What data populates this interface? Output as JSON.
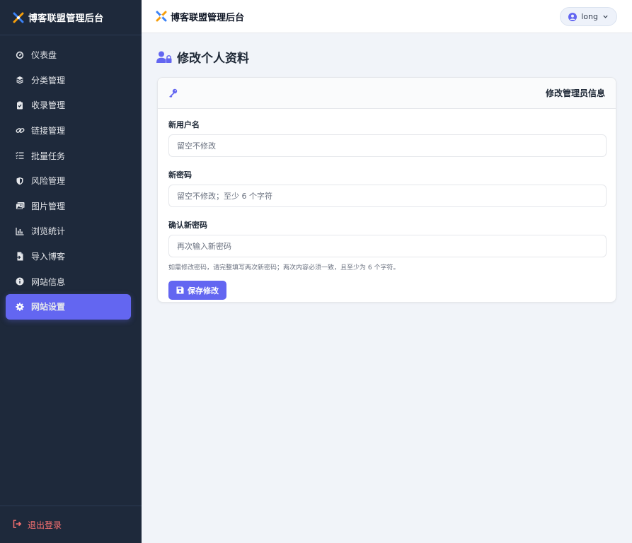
{
  "sidebar": {
    "brand": "博客联盟管理后台",
    "items": [
      {
        "label": "仪表盘",
        "icon": "dashboard-icon"
      },
      {
        "label": "分类管理",
        "icon": "layers-icon"
      },
      {
        "label": "收录管理",
        "icon": "clipboard-check-icon"
      },
      {
        "label": "链接管理",
        "icon": "link-icon"
      },
      {
        "label": "批量任务",
        "icon": "tasks-icon"
      },
      {
        "label": "风险管理",
        "icon": "shield-icon"
      },
      {
        "label": "图片管理",
        "icon": "image-icon"
      },
      {
        "label": "浏览统计",
        "icon": "bar-chart-icon"
      },
      {
        "label": "导入博客",
        "icon": "file-import-icon"
      },
      {
        "label": "网站信息",
        "icon": "info-icon"
      },
      {
        "label": "网站设置",
        "icon": "gear-icon",
        "active": true
      }
    ],
    "logout": "退出登录"
  },
  "topbar": {
    "title": "博客联盟管理后台",
    "user": "long"
  },
  "page": {
    "title": "修改个人资料"
  },
  "card": {
    "title": "修改管理员信息",
    "fields": [
      {
        "label": "新用户名",
        "placeholder": "留空不修改",
        "value": ""
      },
      {
        "label": "新密码",
        "placeholder": "留空不修改；至少 6 个字符",
        "value": ""
      },
      {
        "label": "确认新密码",
        "placeholder": "再次输入新密码",
        "value": ""
      }
    ],
    "hint": "如需修改密码，请完整填写两次新密码；两次内容必须一致，且至少为 6 个字符。",
    "save_label": "保存修改"
  },
  "colors": {
    "sidebar_bg": "#1e293b",
    "accent": "#6366f1",
    "logout": "#f87171",
    "page_bg": "#f1f4f9"
  }
}
